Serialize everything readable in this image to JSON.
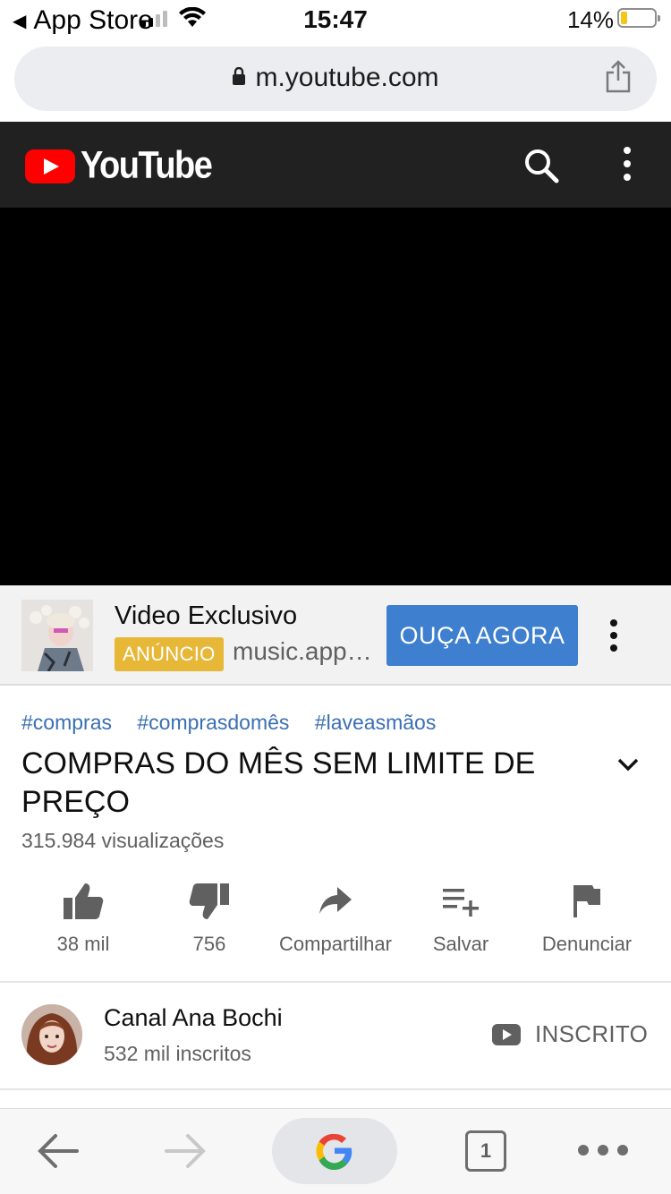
{
  "status_bar": {
    "back_label": "App Store",
    "time": "15:47",
    "battery_text": "14%",
    "battery_level": 0.14,
    "signal_bars": 2
  },
  "browser": {
    "url": "m.youtube.com",
    "open_tabs": "1"
  },
  "header": {
    "logo_text": "YouTube"
  },
  "ad": {
    "title": "Video Exclusivo",
    "badge": "ANÚNCIO",
    "url": "music.apple.com",
    "cta": "OUÇA AGORA"
  },
  "video": {
    "hashtags": [
      "#compras",
      "#comprasdomês",
      "#laveasmãos"
    ],
    "title": "COMPRAS DO MÊS SEM LIMITE DE PREÇO",
    "views": "315.984 visualizações"
  },
  "actions": {
    "like": "38 mil",
    "dislike": "756",
    "share": "Compartilhar",
    "save": "Salvar",
    "report": "Denunciar"
  },
  "channel": {
    "name": "Canal Ana Bochi",
    "subscribers": "532 mil inscritos",
    "subscribe_state": "INSCRITO"
  },
  "colors": {
    "youtube_red": "#ff0000",
    "header_bg": "#212121",
    "ad_button": "#3f7fd0",
    "ad_badge": "#e7b738",
    "hashtag": "#3a6fb3"
  }
}
